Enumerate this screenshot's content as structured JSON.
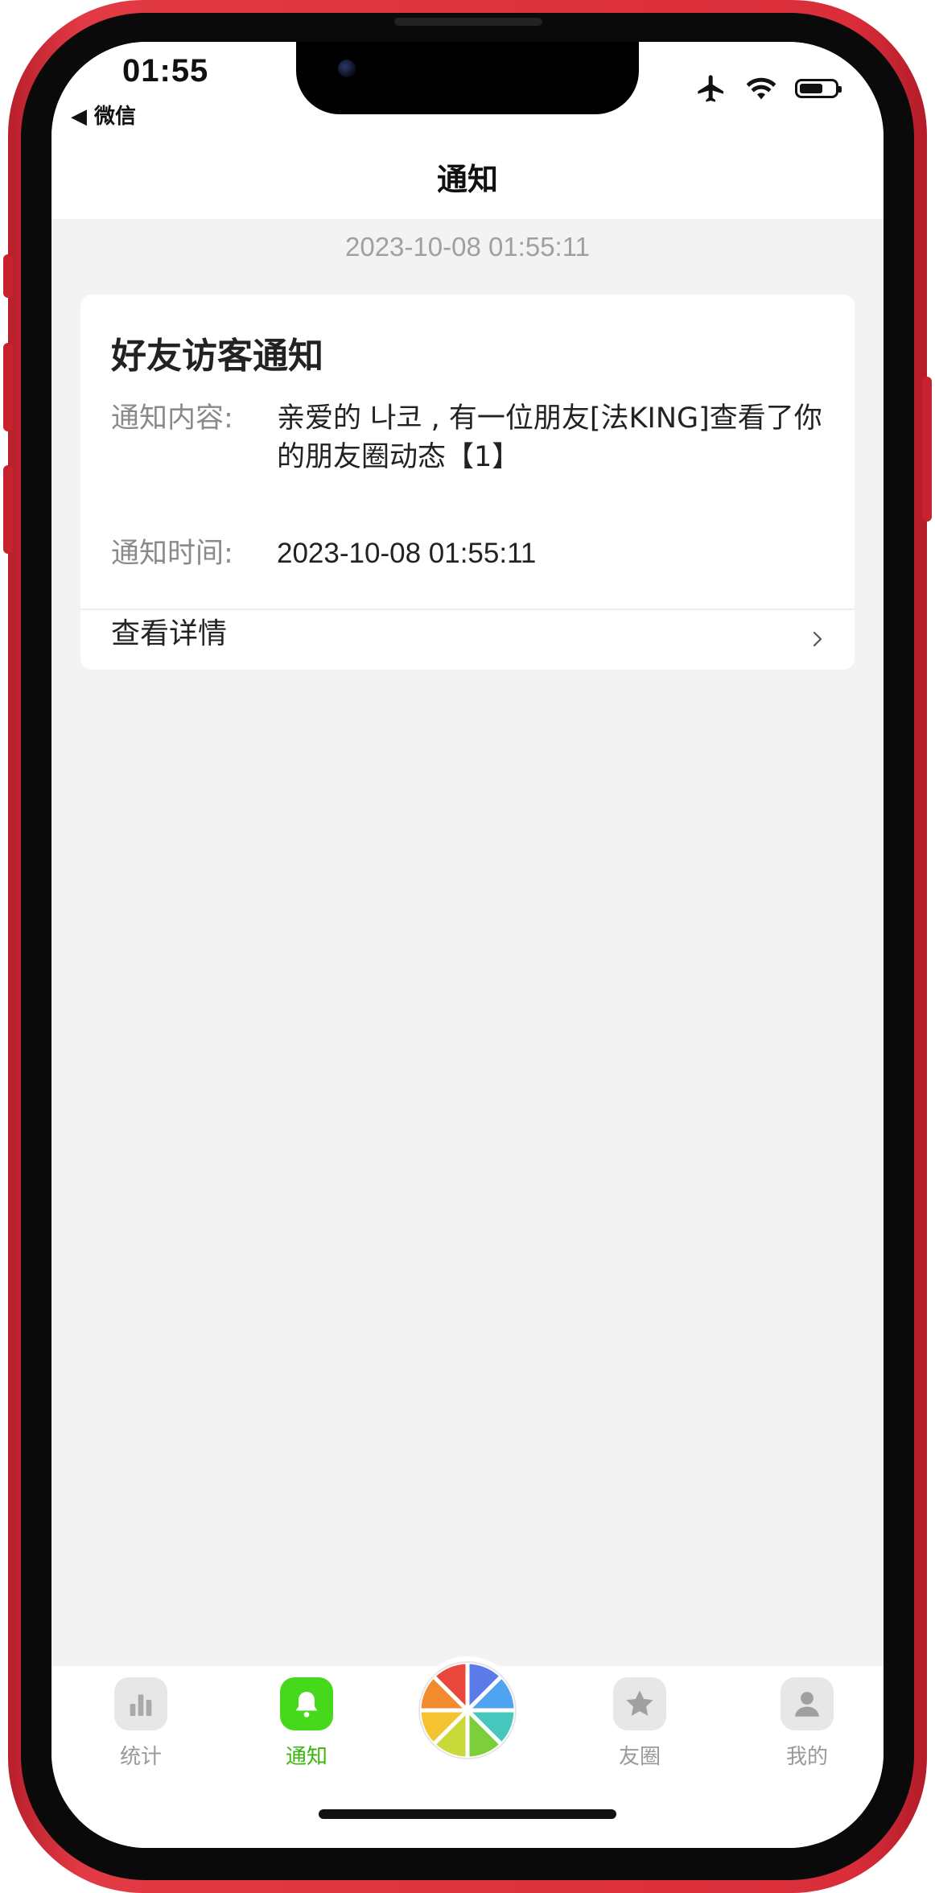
{
  "status_bar": {
    "time": "01:55",
    "back_app": "◀ 微信"
  },
  "nav": {
    "title": "通知"
  },
  "feed": {
    "timestamp": "2023-10-08 01:55:11"
  },
  "card": {
    "title": "好友访客通知",
    "content_label": "通知内容:",
    "content_value": "亲爱的 나코 , 有一位朋友[法KING]查看了你的朋友圈动态【1】",
    "time_label": "通知时间:",
    "time_value": "2023-10-08 01:55:11",
    "detail_label": "查看详情"
  },
  "tabbar": {
    "items": [
      {
        "label": "统计",
        "icon": "bar-chart-icon",
        "active": false
      },
      {
        "label": "通知",
        "icon": "bell-icon",
        "active": true
      },
      {
        "label": "",
        "icon": "color-wheel-icon",
        "active": false
      },
      {
        "label": "友圈",
        "icon": "star-icon",
        "active": false
      },
      {
        "label": "我的",
        "icon": "user-icon",
        "active": false
      }
    ]
  },
  "colors": {
    "accent": "#46d81a",
    "accent_text": "#3ab50e",
    "frame": "#d92d3a",
    "background": "#f3f3f3"
  }
}
